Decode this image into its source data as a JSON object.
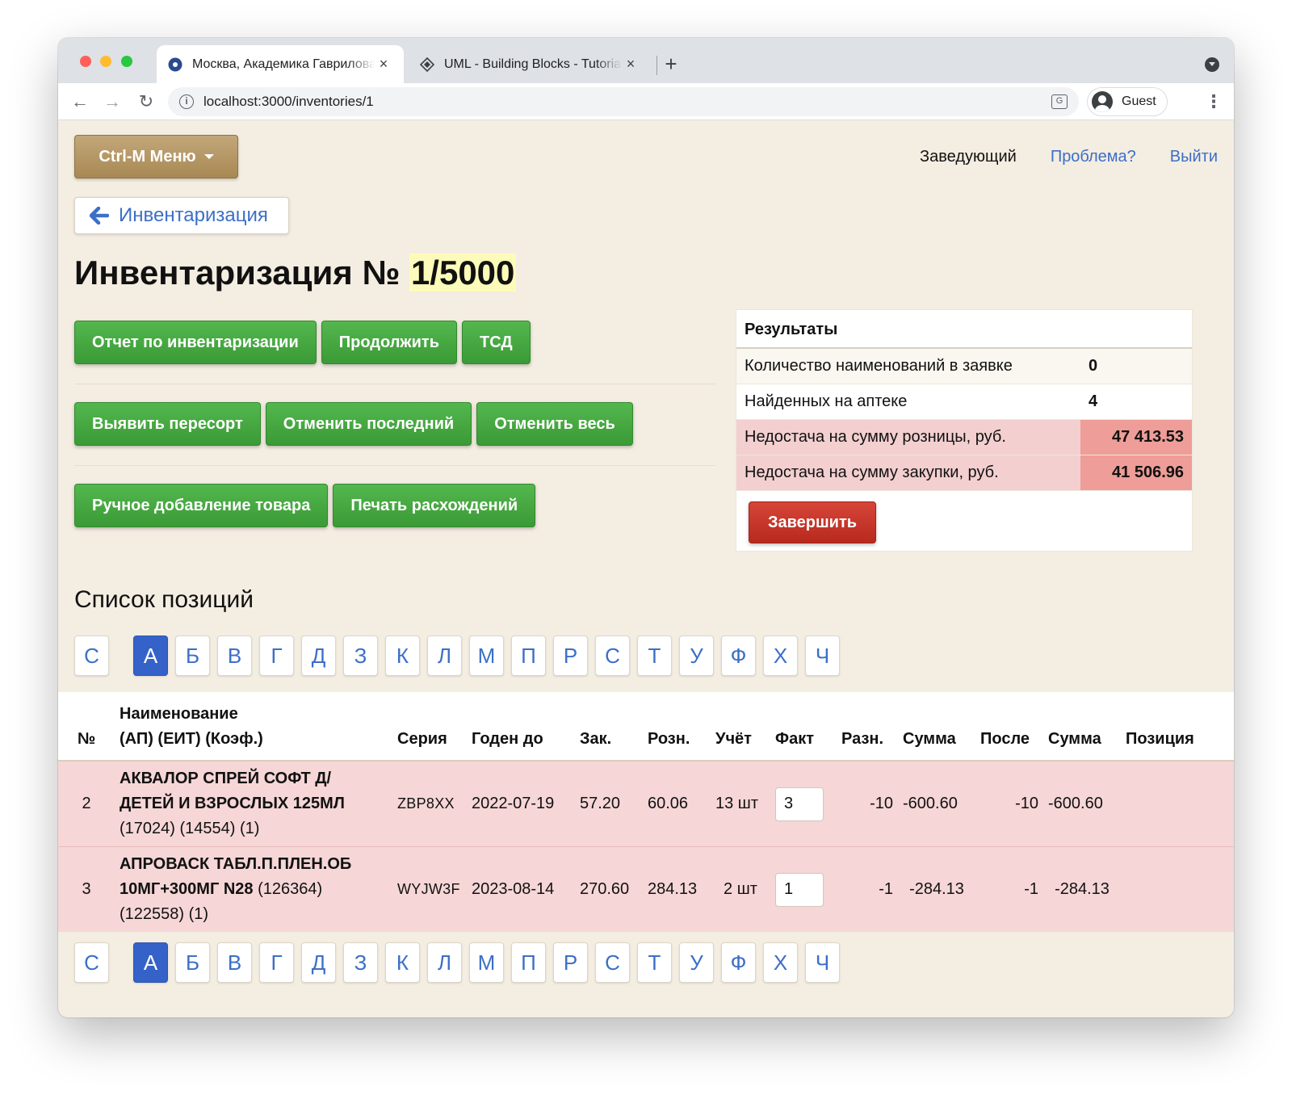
{
  "browser": {
    "tabs": [
      {
        "title": "Москва, Академика Гаврилова",
        "active": true
      },
      {
        "title": "UML - Building Blocks - Tutorialspoint",
        "active": false
      }
    ],
    "url": "localhost:3000/inventories/1",
    "profile": "Guest"
  },
  "header": {
    "menu_label": "Ctrl-M Меню",
    "role": "Заведующий",
    "problem_link": "Проблема?",
    "logout_link": "Выйти"
  },
  "back_link": "Инвентаризация",
  "title": {
    "prefix": "Инвентаризация №",
    "number": "1/5000"
  },
  "actions": {
    "report": "Отчет по инвентаризации",
    "continue": "Продолжить",
    "tsd": "ТСД",
    "resort": "Выявить пересорт",
    "cancel_last": "Отменить последний",
    "cancel_all": "Отменить весь",
    "manual_add": "Ручное добавление товара",
    "print_diff": "Печать расхождений"
  },
  "results": {
    "title": "Результаты",
    "rows": [
      {
        "label": "Количество наименований в заявке",
        "value": "0"
      },
      {
        "label": "Найденных на аптеке",
        "value": "4"
      },
      {
        "label": "Недостача на сумму розницы, руб.",
        "value": "47 413.53"
      },
      {
        "label": "Недостача на сумму закупки, руб.",
        "value": "41 506.96"
      }
    ],
    "finish_label": "Завершить"
  },
  "list_title": "Список позиций",
  "letters": [
    "С",
    "А",
    "Б",
    "В",
    "Г",
    "Д",
    "З",
    "К",
    "Л",
    "М",
    "П",
    "Р",
    "С",
    "Т",
    "У",
    "Ф",
    "Х",
    "Ч"
  ],
  "active_letter": "А",
  "table": {
    "headers": {
      "num": "№",
      "name_line1": "Наименование",
      "name_line2": "(АП) (ЕИТ) (Коэф.)",
      "series": "Серия",
      "expiry": "Годен до",
      "purchase": "Зак.",
      "retail": "Розн.",
      "accounted": "Учёт",
      "fact": "Факт",
      "diff": "Разн.",
      "sum": "Сумма",
      "after": "После",
      "sum2": "Сумма",
      "position": "Позиция"
    },
    "rows": [
      {
        "num": "2",
        "name": "АКВАЛОР СПРЕЙ СОФТ Д/ ДЕТЕЙ И ВЗРОСЛЫХ 125МЛ",
        "codes": "(17024) (14554) (1)",
        "series": "ZBP8XX",
        "expiry": "2022-07-19",
        "purchase": "57.20",
        "retail": "60.06",
        "accounted": "13 шт",
        "fact": "3",
        "diff": "-10",
        "sum": "-600.60",
        "after": "-10",
        "sum2": "-600.60",
        "position": ""
      },
      {
        "num": "3",
        "name": "АПРОВАСК ТАБЛ.П.ПЛЕН.ОБ 10МГ+300МГ N28",
        "codes": "(126364) (122558) (1)",
        "series": "WYJW3F",
        "expiry": "2023-08-14",
        "purchase": "270.60",
        "retail": "284.13",
        "accounted": "2 шт",
        "fact": "1",
        "diff": "-1",
        "sum": "-284.13",
        "after": "-1",
        "sum2": "-284.13",
        "position": ""
      }
    ]
  }
}
